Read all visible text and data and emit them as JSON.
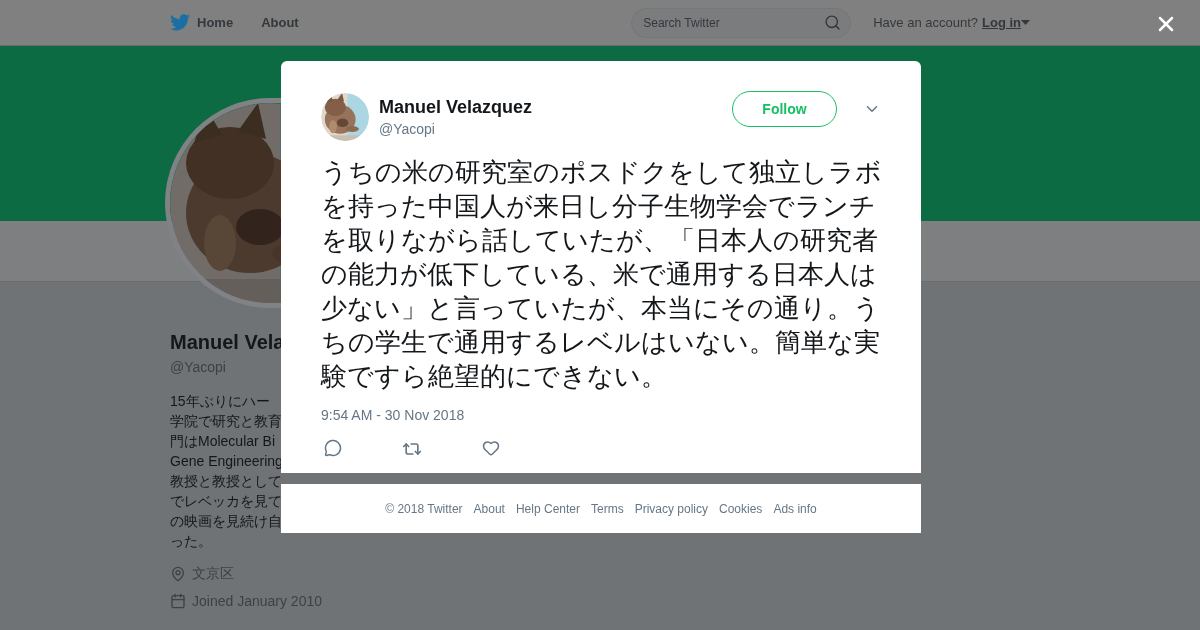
{
  "top_nav": {
    "items": [
      {
        "label": "Home",
        "kind": "home"
      },
      {
        "label": "About",
        "kind": "link"
      }
    ],
    "search": {
      "placeholder": "Search Twitter"
    },
    "account": {
      "prompt": "Have an account?",
      "login": "Log in"
    }
  },
  "profile": {
    "name": "Manuel Vela",
    "handle": "@Yacopi",
    "bio_lines": [
      "15年ぶりにハー",
      "学院で研究と教育",
      "門はMolecular Bi",
      "Gene Engineering",
      "教授と教授として",
      "でレベッカを見て",
      "の映画を見続け自",
      "った。"
    ],
    "location": "文京区",
    "joined": "Joined January 2010"
  },
  "tweet": {
    "name": "Manuel Velazquez",
    "handle": "@Yacopi",
    "follow": "Follow",
    "text": "うちの米の研究室のポスドクをして独立しラボを持った中国人が来日し分子生物学会でランチを取りながら話していたが、「日本人の研究者の能力が低下している、米で通用する日本人は少ない」と言っていたが、本当にその通り。うちの学生で通用するレベルはいない。簡単な実験ですら絶望的にできない。",
    "timestamp": "9:54 AM - 30 Nov 2018"
  },
  "footer": {
    "links": [
      "© 2018 Twitter",
      "About",
      "Help Center",
      "Terms",
      "Privacy policy",
      "Cookies",
      "Ads info"
    ]
  }
}
